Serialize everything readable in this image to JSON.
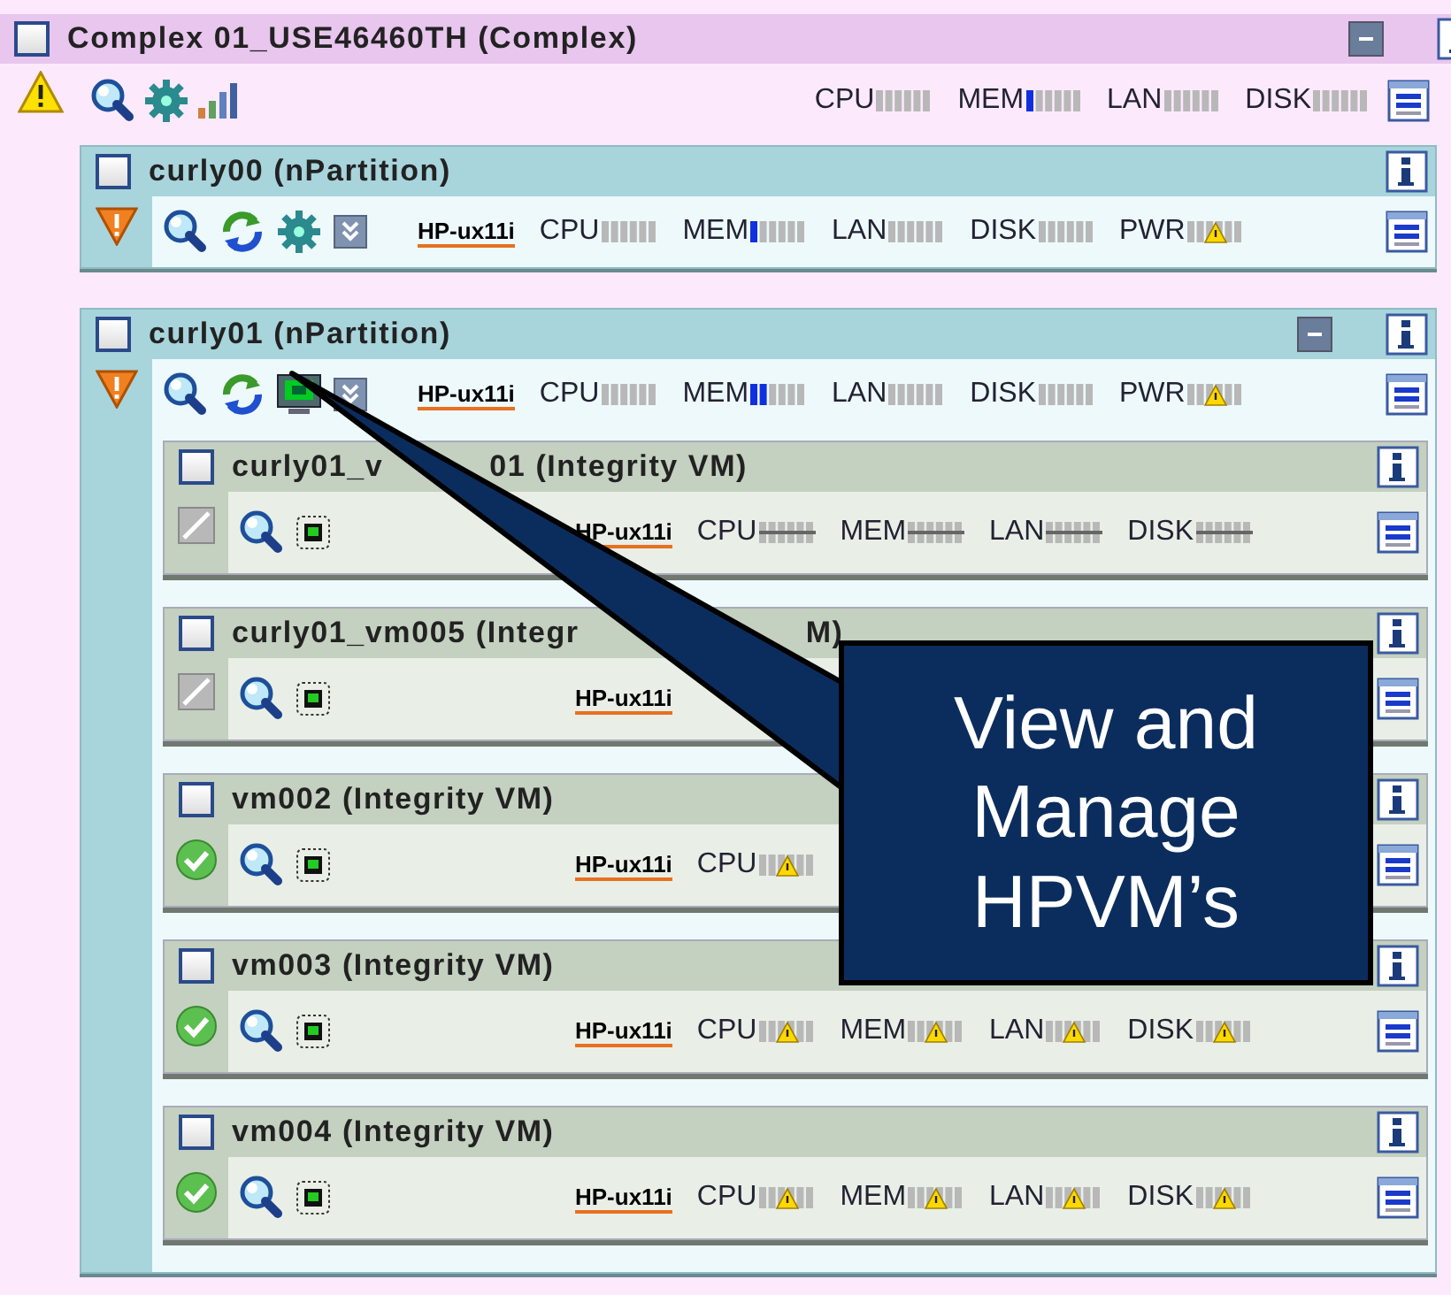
{
  "complex": {
    "title": "Complex 01_USE46460TH (Complex)",
    "checked": false,
    "expanded": true,
    "status": {
      "kind": "warning"
    },
    "tools": [
      {
        "kind": "search"
      },
      {
        "kind": "gear"
      },
      {
        "kind": "bars"
      }
    ],
    "metrics": [
      {
        "label": "CPU",
        "kind": "idle"
      },
      {
        "label": "MEM",
        "kind": "low"
      },
      {
        "label": "LAN",
        "kind": "idle"
      },
      {
        "label": "DISK",
        "kind": "idle"
      }
    ],
    "children": [
      {
        "title": "curly00 (nPartition)",
        "checked": false,
        "status": {
          "kind": "critical"
        },
        "tools": [
          {
            "kind": "search"
          },
          {
            "kind": "refresh"
          },
          {
            "kind": "gear"
          },
          {
            "kind": "expand"
          }
        ],
        "os_logo": "HP-ux11i",
        "metrics": [
          {
            "label": "CPU",
            "kind": "idle"
          },
          {
            "label": "MEM",
            "kind": "low"
          },
          {
            "label": "LAN",
            "kind": "idle"
          },
          {
            "label": "DISK",
            "kind": "idle"
          },
          {
            "label": "PWR",
            "kind": "warning"
          }
        ]
      },
      {
        "title": "curly01 (nPartition)",
        "checked": false,
        "expanded": true,
        "status": {
          "kind": "critical"
        },
        "tools": [
          {
            "kind": "search"
          },
          {
            "kind": "refresh"
          },
          {
            "kind": "monitor"
          },
          {
            "kind": "expand"
          }
        ],
        "os_logo": "HP-ux11i",
        "metrics": [
          {
            "label": "CPU",
            "kind": "idle"
          },
          {
            "label": "MEM",
            "kind": "medium"
          },
          {
            "label": "LAN",
            "kind": "idle"
          },
          {
            "label": "DISK",
            "kind": "idle"
          },
          {
            "label": "PWR",
            "kind": "warning"
          }
        ],
        "children": [
          {
            "title_parts": [
              "curly01_v",
              "01 (Integrity VM)"
            ],
            "checked": false,
            "status": {
              "kind": "disabled"
            },
            "tools": [
              {
                "kind": "search"
              },
              {
                "kind": "chip"
              }
            ],
            "os_logo": "HP-ux11i",
            "metrics": [
              {
                "label": "CPU",
                "kind": "unknown"
              },
              {
                "label": "MEM",
                "kind": "unknown"
              },
              {
                "label": "LAN",
                "kind": "unknown"
              },
              {
                "label": "DISK",
                "kind": "unknown"
              }
            ]
          },
          {
            "title_parts": [
              "curly01_vm005 (Integr",
              "M)"
            ],
            "checked": false,
            "status": {
              "kind": "disabled"
            },
            "tools": [
              {
                "kind": "search"
              },
              {
                "kind": "chip"
              }
            ],
            "os_logo": "HP-ux11i"
          },
          {
            "title_parts": [
              "vm002 (Integrity VM)"
            ],
            "checked": false,
            "status": {
              "kind": "ok"
            },
            "tools": [
              {
                "kind": "search"
              },
              {
                "kind": "chip"
              }
            ],
            "os_logo": "HP-ux11i",
            "metrics": [
              {
                "label": "CPU",
                "kind": "warning"
              }
            ]
          },
          {
            "title_parts": [
              "vm003 (Integrity VM)"
            ],
            "checked": false,
            "status": {
              "kind": "ok"
            },
            "tools": [
              {
                "kind": "search"
              },
              {
                "kind": "chip"
              }
            ],
            "os_logo": "HP-ux11i",
            "metrics": [
              {
                "label": "CPU",
                "kind": "warning"
              },
              {
                "label": "MEM",
                "kind": "warning"
              },
              {
                "label": "LAN",
                "kind": "warning"
              },
              {
                "label": "DISK",
                "kind": "warning"
              }
            ]
          },
          {
            "title_parts": [
              "vm004 (Integrity VM)"
            ],
            "checked": false,
            "status": {
              "kind": "ok"
            },
            "tools": [
              {
                "kind": "search"
              },
              {
                "kind": "chip"
              }
            ],
            "os_logo": "HP-ux11i",
            "metrics": [
              {
                "label": "CPU",
                "kind": "warning"
              },
              {
                "label": "MEM",
                "kind": "warning"
              },
              {
                "label": "LAN",
                "kind": "warning"
              },
              {
                "label": "DISK",
                "kind": "warning"
              }
            ]
          }
        ]
      }
    ]
  },
  "callout": {
    "text": "View and Manage HPVM’s"
  }
}
